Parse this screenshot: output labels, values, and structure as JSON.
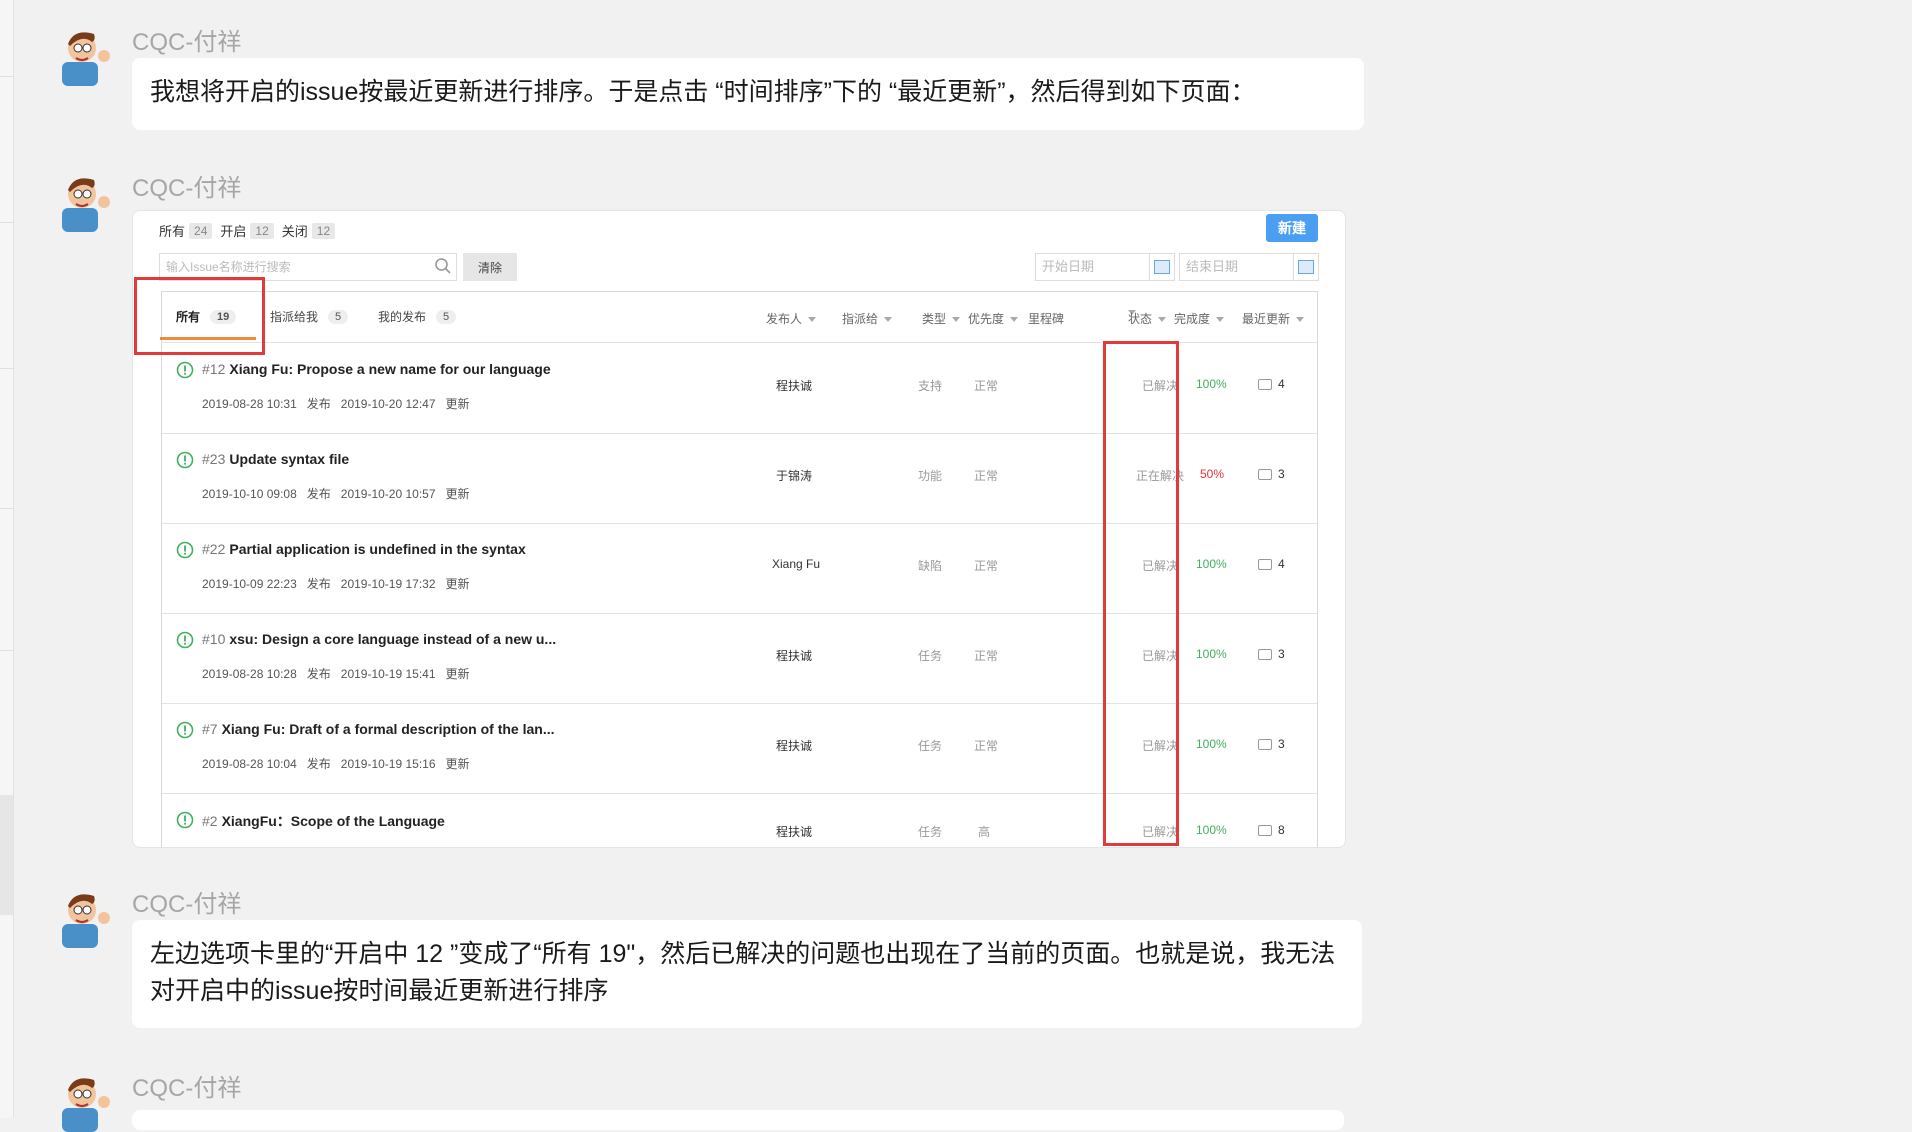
{
  "messages": [
    {
      "sender": "CQC-付祥",
      "text": "我想将开启的issue按最近更新进行排序。于是点击 “时间排序”下的 “最近更新”，然后得到如下页面："
    },
    {
      "sender": "CQC-付祥"
    },
    {
      "sender": "CQC-付祥",
      "text": "左边选项卡里的“开启中 12 ”变成了“所有 19\"，然后已解决的问题也出现在了当前的页面。也就是说，我无法对开启中的issue按时间最近更新进行排序"
    },
    {
      "sender": "CQC-付祥"
    }
  ],
  "shot": {
    "filters": [
      {
        "label": "所有",
        "count": "24"
      },
      {
        "label": "开启",
        "count": "12"
      },
      {
        "label": "关闭",
        "count": "12"
      }
    ],
    "new_button": "新建",
    "search_placeholder": "输入Issue名称进行搜索",
    "clear_button": "清除",
    "start_date": "开始日期",
    "end_date": "结束日期",
    "tabs": [
      {
        "label": "所有",
        "count": "19"
      },
      {
        "label": "指派给我",
        "count": "5"
      },
      {
        "label": "我的发布",
        "count": "5"
      }
    ],
    "columns": [
      "发布人",
      "指派给",
      "类型",
      "优先度",
      "里程碑",
      "状态",
      "完成度",
      "最近更新"
    ],
    "rows": [
      {
        "num": "#12",
        "title": "Xiang Fu: Propose a new name for our language",
        "created": "2019-08-28 10:31",
        "created_label": "发布",
        "updated": "2019-10-20 12:47",
        "updated_label": "更新",
        "author": "程扶诚",
        "type": "支持",
        "priority": "正常",
        "status": "已解决",
        "progress": "100%",
        "comments": "4"
      },
      {
        "num": "#23",
        "title": "Update syntax file",
        "created": "2019-10-10 09:08",
        "created_label": "发布",
        "updated": "2019-10-20 10:57",
        "updated_label": "更新",
        "author": "于锦涛",
        "type": "功能",
        "priority": "正常",
        "status": "正在解决",
        "progress": "50%",
        "comments": "3"
      },
      {
        "num": "#22",
        "title": "Partial application is undefined in the syntax",
        "created": "2019-10-09 22:23",
        "created_label": "发布",
        "updated": "2019-10-19 17:32",
        "updated_label": "更新",
        "author": "Xiang Fu",
        "type": "缺陷",
        "priority": "正常",
        "status": "已解决",
        "progress": "100%",
        "comments": "4"
      },
      {
        "num": "#10",
        "title": "xsu: Design a core language instead of a new u...",
        "created": "2019-08-28 10:28",
        "created_label": "发布",
        "updated": "2019-10-19 15:41",
        "updated_label": "更新",
        "author": "程扶诚",
        "type": "任务",
        "priority": "正常",
        "status": "已解决",
        "progress": "100%",
        "comments": "3"
      },
      {
        "num": "#7",
        "title": "Xiang Fu: Draft of a formal description of the lan...",
        "created": "2019-08-28 10:04",
        "created_label": "发布",
        "updated": "2019-10-19 15:16",
        "updated_label": "更新",
        "author": "程扶诚",
        "type": "任务",
        "priority": "正常",
        "status": "已解决",
        "progress": "100%",
        "comments": "3"
      },
      {
        "num": "#2",
        "title": "XiangFu：Scope of the Language",
        "author": "程扶诚",
        "type": "任务",
        "priority": "高",
        "status": "已解决",
        "progress": "100%",
        "comments": "8"
      }
    ]
  }
}
